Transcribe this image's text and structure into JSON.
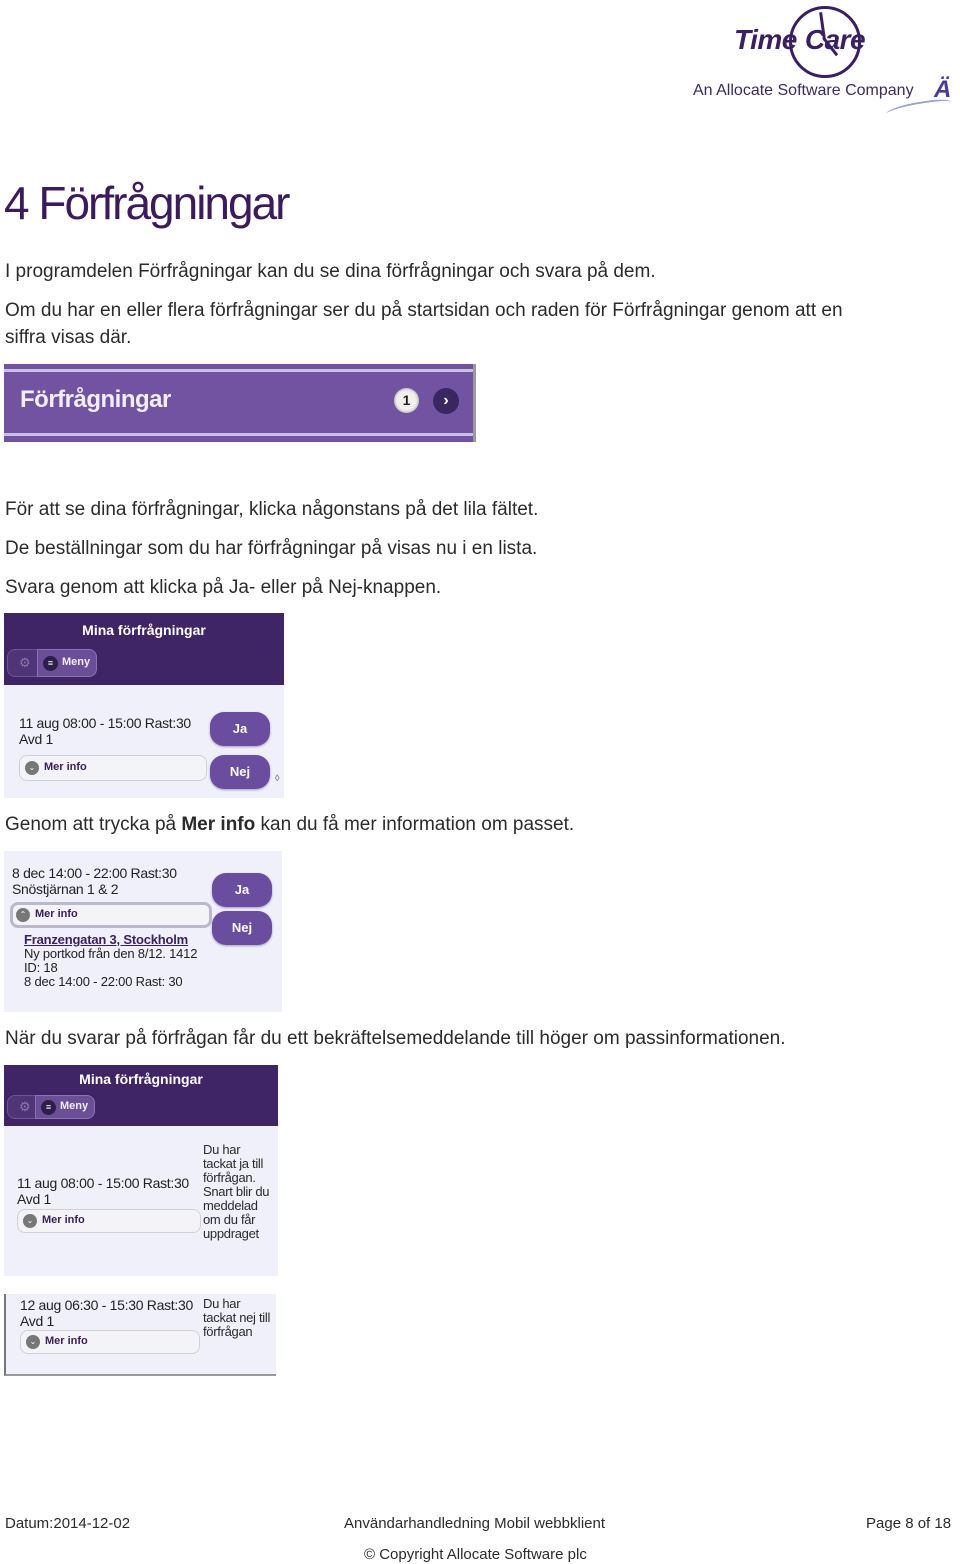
{
  "logo": {
    "brand_left": "Time",
    "brand_right": "Care",
    "tagline": "An Allocate Software Company",
    "mark": "Ä"
  },
  "heading": "4  Förfrågningar",
  "paragraphs": {
    "p1": "I programdelen Förfrågningar kan du se dina förfrågningar och svara på dem.",
    "p2_line1": "Om du har en eller flera förfrågningar ser du på startsidan och raden för Förfrågningar genom att en",
    "p2_line2": "siffra visas där.",
    "p3": "För att se dina förfrågningar, klicka någonstans på det lila fältet.",
    "p4": "De beställningar som du har förfrågningar på visas nu i en lista.",
    "p5": "Svara genom att klicka på Ja- eller på Nej-knappen.",
    "p6_before": "Genom att trycka på ",
    "p6_bold": "Mer info",
    "p6_after": " kan du få mer information om passet.",
    "p7": "När du svarar på förfrågan får du ett bekräftelsemeddelande till höger om passinformationen."
  },
  "banner": {
    "label": "Förfrågningar",
    "count": "1",
    "arrow_icon": "chevron-right-icon",
    "color": "#7253a2"
  },
  "app": {
    "header_title": "Mina förfrågningar",
    "menu_label": "Meny",
    "more_info_label": "Mer info",
    "yes_label": "Ja",
    "no_label": "Nej",
    "header_color": "#3f2566",
    "button_color": "#6a4d9e"
  },
  "screen1": {
    "shift_line1": "11 aug 08:00 - 15:00 Rast:30",
    "shift_line2": "Avd 1"
  },
  "screen2": {
    "shift_line1": "8 dec 14:00 - 22:00 Rast:30",
    "shift_line2": "Snöstjärnan 1 & 2",
    "address": "Franzengatan 3, Stockholm",
    "note": "Ny portkod från den 8/12. 1412",
    "id": "ID: 18",
    "shift_detail": "8 dec 14:00 - 22:00 Rast: 30"
  },
  "screen3": {
    "shift_line1": "11 aug 08:00 - 15:00 Rast:30",
    "shift_line2": "Avd 1",
    "reply": "Du har tackat ja till förfrågan. Snart blir du meddelad om du får uppdraget"
  },
  "screen4": {
    "shift_line1": "12 aug 06:30 - 15:30 Rast:30",
    "shift_line2": "Avd 1",
    "reply": "Du har tackat nej till förfrågan"
  },
  "footer": {
    "date": "Datum:2014-12-02",
    "doc_title": "Användarhandledning Mobil webbklient",
    "page": "Page 8 of 18",
    "copyright": "© Copyright Allocate Software plc"
  }
}
